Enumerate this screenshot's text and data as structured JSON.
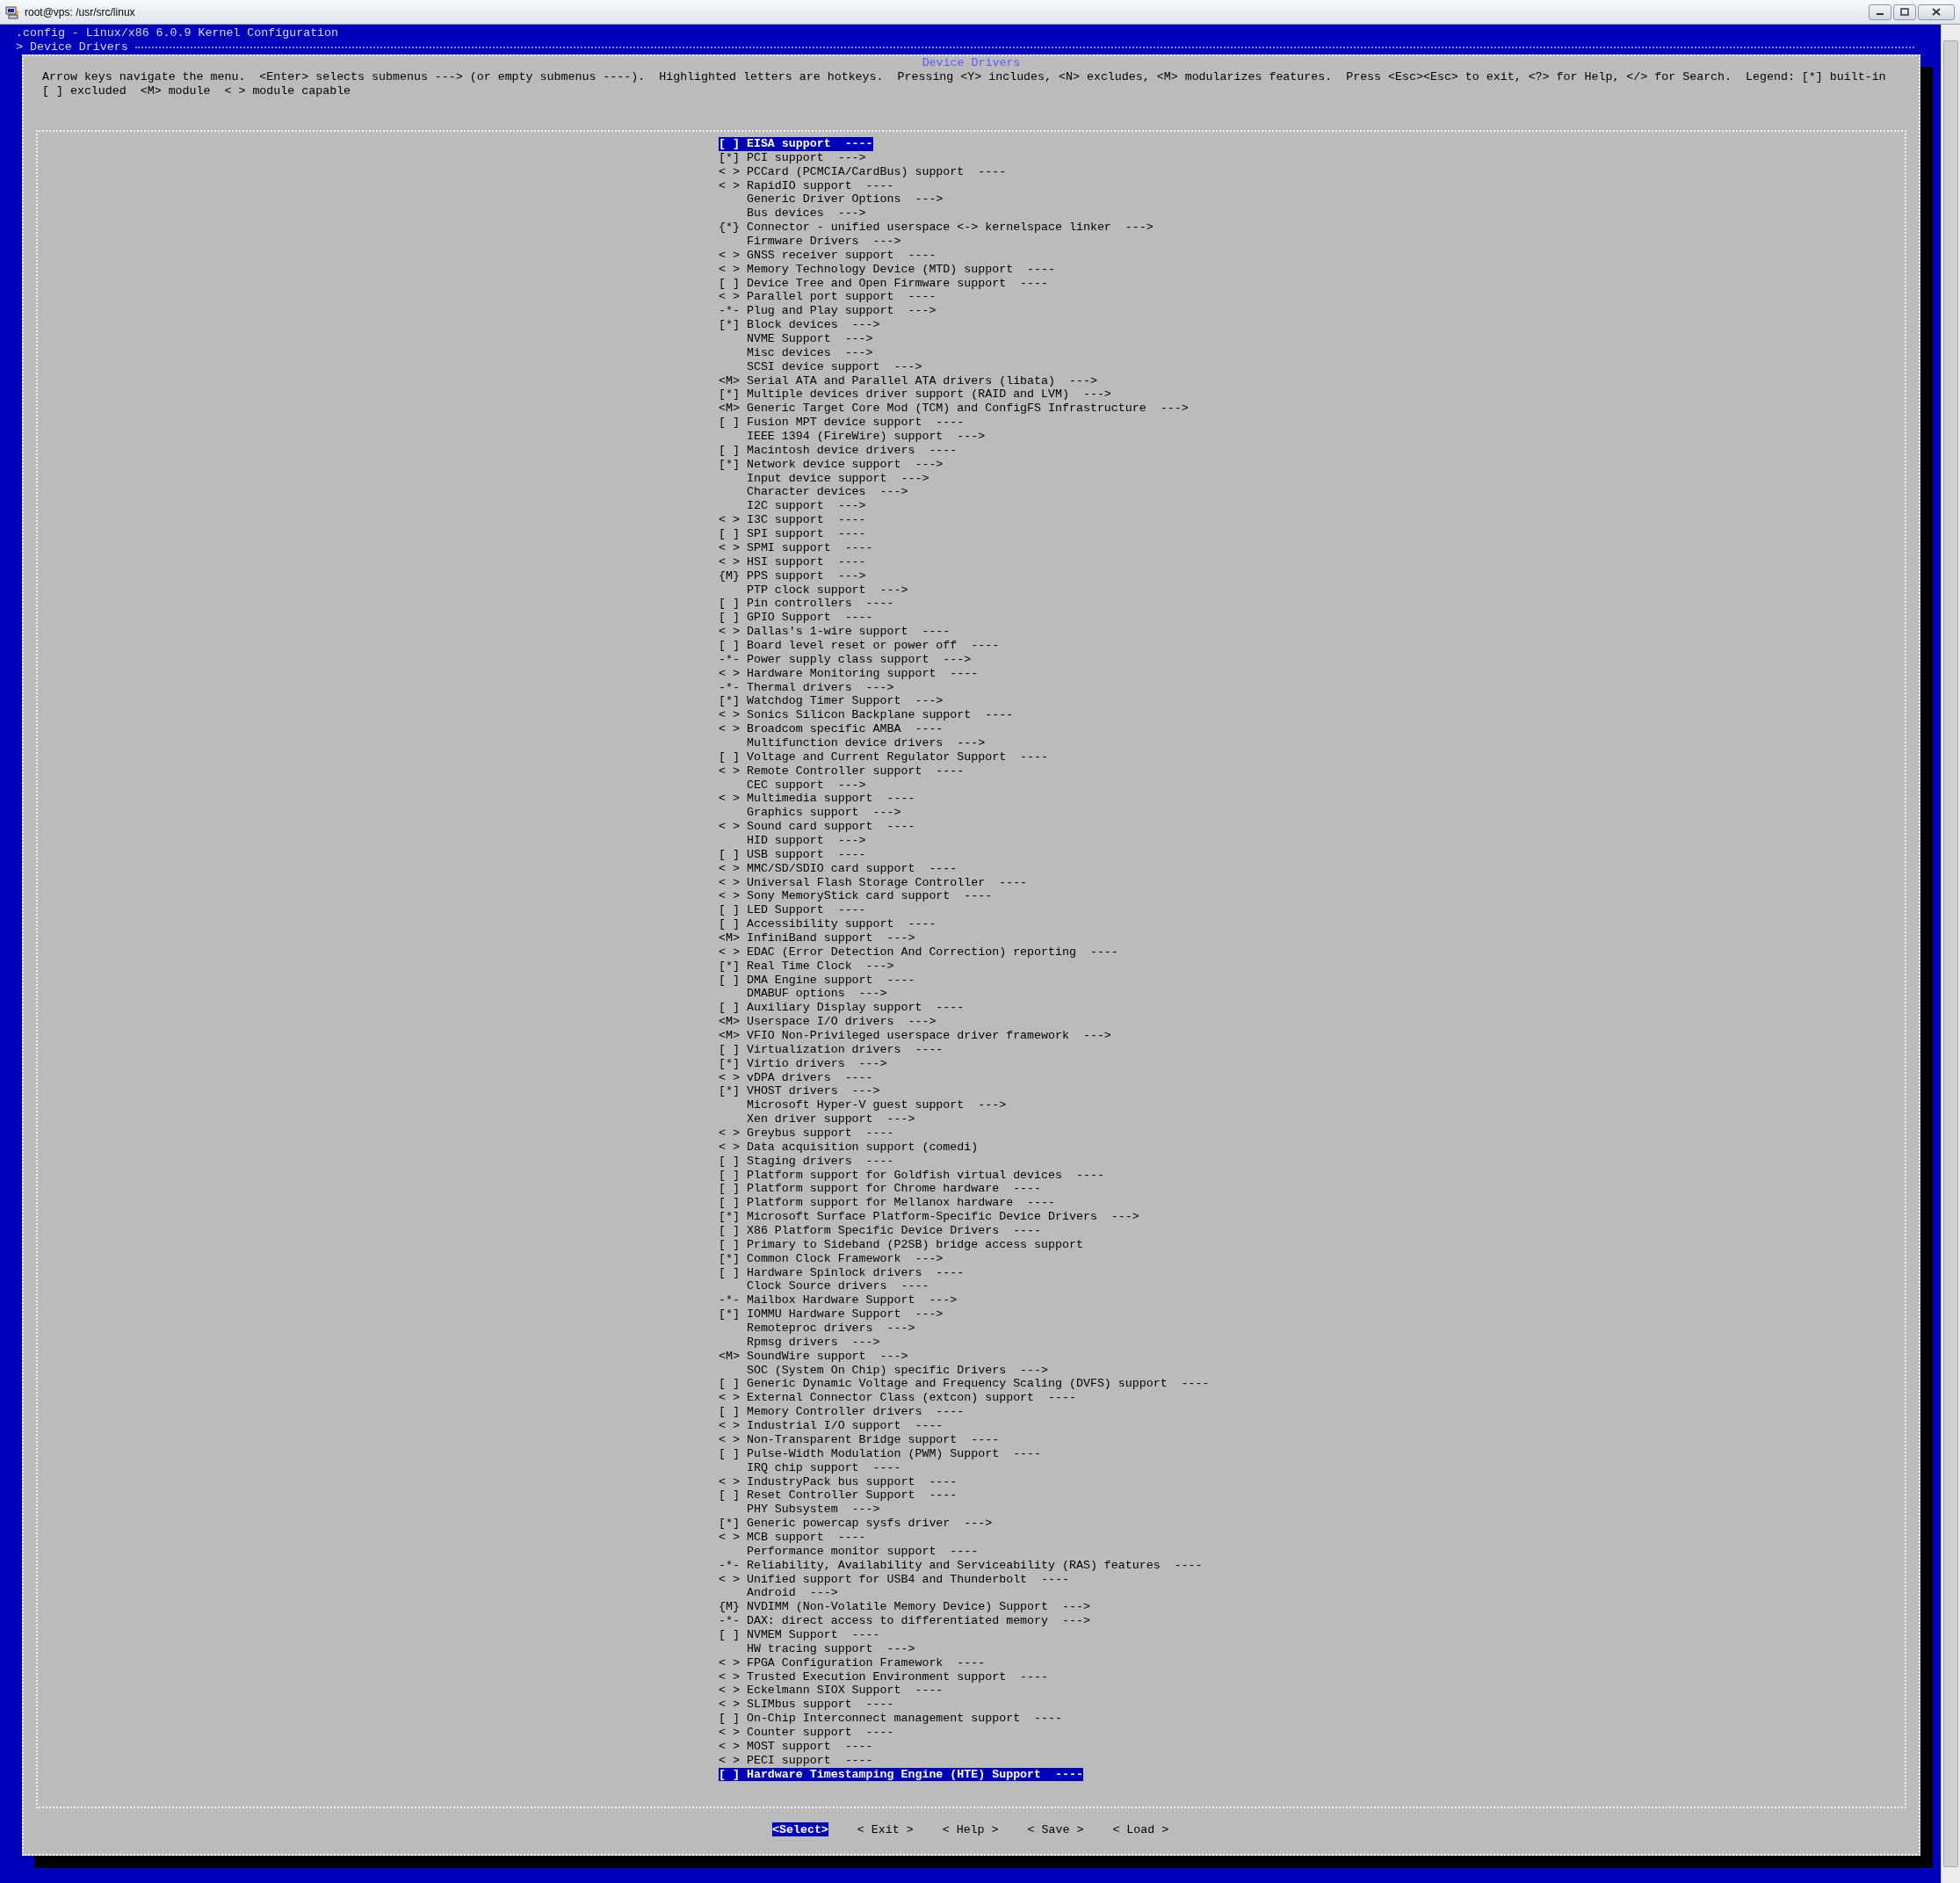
{
  "window": {
    "title": "root@vps: /usr/src/linux"
  },
  "terminal": {
    "heading": ".config - Linux/x86 6.0.9 Kernel Configuration",
    "breadcrumb": "> Device Drivers"
  },
  "dialog": {
    "title": "Device Drivers",
    "help": "Arrow keys navigate the menu.  <Enter> selects submenus ---> (or empty submenus ----).  Highlighted letters are hotkeys.  Pressing <Y> includes, <N> excludes, <M> modularizes features.  Press <Esc><Esc> to exit, <?> for Help, </> for Search.  Legend: [*] built-in [ ] excluded  <M> module  < > module capable",
    "items": [
      {
        "text": "[ ] EISA support  ----",
        "selected": true
      },
      {
        "text": "[*] PCI support  --->",
        "selected": false
      },
      {
        "text": "< > PCCard (PCMCIA/CardBus) support  ----",
        "selected": false
      },
      {
        "text": "< > RapidIO support  ----",
        "selected": false
      },
      {
        "text": "    Generic Driver Options  --->",
        "selected": false
      },
      {
        "text": "    Bus devices  --->",
        "selected": false
      },
      {
        "text": "{*} Connector - unified userspace <-> kernelspace linker  --->",
        "selected": false
      },
      {
        "text": "    Firmware Drivers  --->",
        "selected": false
      },
      {
        "text": "< > GNSS receiver support  ----",
        "selected": false
      },
      {
        "text": "< > Memory Technology Device (MTD) support  ----",
        "selected": false
      },
      {
        "text": "[ ] Device Tree and Open Firmware support  ----",
        "selected": false
      },
      {
        "text": "< > Parallel port support  ----",
        "selected": false
      },
      {
        "text": "-*- Plug and Play support  --->",
        "selected": false
      },
      {
        "text": "[*] Block devices  --->",
        "selected": false
      },
      {
        "text": "    NVME Support  --->",
        "selected": false
      },
      {
        "text": "    Misc devices  --->",
        "selected": false
      },
      {
        "text": "    SCSI device support  --->",
        "selected": false
      },
      {
        "text": "<M> Serial ATA and Parallel ATA drivers (libata)  --->",
        "selected": false
      },
      {
        "text": "[*] Multiple devices driver support (RAID and LVM)  --->",
        "selected": false
      },
      {
        "text": "<M> Generic Target Core Mod (TCM) and ConfigFS Infrastructure  --->",
        "selected": false
      },
      {
        "text": "[ ] Fusion MPT device support  ----",
        "selected": false
      },
      {
        "text": "    IEEE 1394 (FireWire) support  --->",
        "selected": false
      },
      {
        "text": "[ ] Macintosh device drivers  ----",
        "selected": false
      },
      {
        "text": "[*] Network device support  --->",
        "selected": false
      },
      {
        "text": "    Input device support  --->",
        "selected": false
      },
      {
        "text": "    Character devices  --->",
        "selected": false
      },
      {
        "text": "    I2C support  --->",
        "selected": false
      },
      {
        "text": "< > I3C support  ----",
        "selected": false
      },
      {
        "text": "[ ] SPI support  ----",
        "selected": false
      },
      {
        "text": "< > SPMI support  ----",
        "selected": false
      },
      {
        "text": "< > HSI support  ----",
        "selected": false
      },
      {
        "text": "{M} PPS support  --->",
        "selected": false
      },
      {
        "text": "    PTP clock support  --->",
        "selected": false
      },
      {
        "text": "[ ] Pin controllers  ----",
        "selected": false
      },
      {
        "text": "[ ] GPIO Support  ----",
        "selected": false
      },
      {
        "text": "< > Dallas's 1-wire support  ----",
        "selected": false
      },
      {
        "text": "[ ] Board level reset or power off  ----",
        "selected": false
      },
      {
        "text": "-*- Power supply class support  --->",
        "selected": false
      },
      {
        "text": "< > Hardware Monitoring support  ----",
        "selected": false
      },
      {
        "text": "-*- Thermal drivers  --->",
        "selected": false
      },
      {
        "text": "[*] Watchdog Timer Support  --->",
        "selected": false
      },
      {
        "text": "< > Sonics Silicon Backplane support  ----",
        "selected": false
      },
      {
        "text": "< > Broadcom specific AMBA  ----",
        "selected": false
      },
      {
        "text": "    Multifunction device drivers  --->",
        "selected": false
      },
      {
        "text": "[ ] Voltage and Current Regulator Support  ----",
        "selected": false
      },
      {
        "text": "< > Remote Controller support  ----",
        "selected": false
      },
      {
        "text": "    CEC support  --->",
        "selected": false
      },
      {
        "text": "< > Multimedia support  ----",
        "selected": false
      },
      {
        "text": "    Graphics support  --->",
        "selected": false
      },
      {
        "text": "< > Sound card support  ----",
        "selected": false
      },
      {
        "text": "    HID support  --->",
        "selected": false
      },
      {
        "text": "[ ] USB support  ----",
        "selected": false
      },
      {
        "text": "< > MMC/SD/SDIO card support  ----",
        "selected": false
      },
      {
        "text": "< > Universal Flash Storage Controller  ----",
        "selected": false
      },
      {
        "text": "< > Sony MemoryStick card support  ----",
        "selected": false
      },
      {
        "text": "[ ] LED Support  ----",
        "selected": false
      },
      {
        "text": "[ ] Accessibility support  ----",
        "selected": false
      },
      {
        "text": "<M> InfiniBand support  --->",
        "selected": false
      },
      {
        "text": "< > EDAC (Error Detection And Correction) reporting  ----",
        "selected": false
      },
      {
        "text": "[*] Real Time Clock  --->",
        "selected": false
      },
      {
        "text": "[ ] DMA Engine support  ----",
        "selected": false
      },
      {
        "text": "    DMABUF options  --->",
        "selected": false
      },
      {
        "text": "[ ] Auxiliary Display support  ----",
        "selected": false
      },
      {
        "text": "<M> Userspace I/O drivers  --->",
        "selected": false
      },
      {
        "text": "<M> VFIO Non-Privileged userspace driver framework  --->",
        "selected": false
      },
      {
        "text": "[ ] Virtualization drivers  ----",
        "selected": false
      },
      {
        "text": "[*] Virtio drivers  --->",
        "selected": false
      },
      {
        "text": "< > vDPA drivers  ----",
        "selected": false
      },
      {
        "text": "[*] VHOST drivers  --->",
        "selected": false
      },
      {
        "text": "    Microsoft Hyper-V guest support  --->",
        "selected": false
      },
      {
        "text": "    Xen driver support  --->",
        "selected": false
      },
      {
        "text": "< > Greybus support  ----",
        "selected": false
      },
      {
        "text": "< > Data acquisition support (comedi)",
        "selected": false
      },
      {
        "text": "[ ] Staging drivers  ----",
        "selected": false
      },
      {
        "text": "[ ] Platform support for Goldfish virtual devices  ----",
        "selected": false
      },
      {
        "text": "[ ] Platform support for Chrome hardware  ----",
        "selected": false
      },
      {
        "text": "[ ] Platform support for Mellanox hardware  ----",
        "selected": false
      },
      {
        "text": "[*] Microsoft Surface Platform-Specific Device Drivers  --->",
        "selected": false
      },
      {
        "text": "[ ] X86 Platform Specific Device Drivers  ----",
        "selected": false
      },
      {
        "text": "[ ] Primary to Sideband (P2SB) bridge access support",
        "selected": false
      },
      {
        "text": "[*] Common Clock Framework  --->",
        "selected": false
      },
      {
        "text": "[ ] Hardware Spinlock drivers  ----",
        "selected": false
      },
      {
        "text": "    Clock Source drivers  ----",
        "selected": false
      },
      {
        "text": "-*- Mailbox Hardware Support  --->",
        "selected": false
      },
      {
        "text": "[*] IOMMU Hardware Support  --->",
        "selected": false
      },
      {
        "text": "    Remoteproc drivers  --->",
        "selected": false
      },
      {
        "text": "    Rpmsg drivers  --->",
        "selected": false
      },
      {
        "text": "<M> SoundWire support  --->",
        "selected": false
      },
      {
        "text": "    SOC (System On Chip) specific Drivers  --->",
        "selected": false
      },
      {
        "text": "[ ] Generic Dynamic Voltage and Frequency Scaling (DVFS) support  ----",
        "selected": false
      },
      {
        "text": "< > External Connector Class (extcon) support  ----",
        "selected": false
      },
      {
        "text": "[ ] Memory Controller drivers  ----",
        "selected": false
      },
      {
        "text": "< > Industrial I/O support  ----",
        "selected": false
      },
      {
        "text": "< > Non-Transparent Bridge support  ----",
        "selected": false
      },
      {
        "text": "[ ] Pulse-Width Modulation (PWM) Support  ----",
        "selected": false
      },
      {
        "text": "    IRQ chip support  ----",
        "selected": false
      },
      {
        "text": "< > IndustryPack bus support  ----",
        "selected": false
      },
      {
        "text": "[ ] Reset Controller Support  ----",
        "selected": false
      },
      {
        "text": "    PHY Subsystem  --->",
        "selected": false
      },
      {
        "text": "[*] Generic powercap sysfs driver  --->",
        "selected": false
      },
      {
        "text": "< > MCB support  ----",
        "selected": false
      },
      {
        "text": "    Performance monitor support  ----",
        "selected": false
      },
      {
        "text": "-*- Reliability, Availability and Serviceability (RAS) features  ----",
        "selected": false
      },
      {
        "text": "< > Unified support for USB4 and Thunderbolt  ----",
        "selected": false
      },
      {
        "text": "    Android  --->",
        "selected": false
      },
      {
        "text": "{M} NVDIMM (Non-Volatile Memory Device) Support  --->",
        "selected": false
      },
      {
        "text": "-*- DAX: direct access to differentiated memory  --->",
        "selected": false
      },
      {
        "text": "[ ] NVMEM Support  ----",
        "selected": false
      },
      {
        "text": "    HW tracing support  --->",
        "selected": false
      },
      {
        "text": "< > FPGA Configuration Framework  ----",
        "selected": false
      },
      {
        "text": "< > Trusted Execution Environment support  ----",
        "selected": false
      },
      {
        "text": "< > Eckelmann SIOX Support  ----",
        "selected": false
      },
      {
        "text": "< > SLIMbus support  ----",
        "selected": false
      },
      {
        "text": "[ ] On-Chip Interconnect management support  ----",
        "selected": false
      },
      {
        "text": "< > Counter support  ----",
        "selected": false
      },
      {
        "text": "< > MOST support  ----",
        "selected": false
      },
      {
        "text": "< > PECI support  ----",
        "selected": false
      },
      {
        "text": "[ ] Hardware Timestamping Engine (HTE) Support  ----",
        "selected": true
      }
    ],
    "buttons": [
      {
        "label": "<Select>",
        "selected": true
      },
      {
        "label": "< Exit >",
        "selected": false
      },
      {
        "label": "< Help >",
        "selected": false
      },
      {
        "label": "< Save >",
        "selected": false
      },
      {
        "label": "< Load >",
        "selected": false
      }
    ]
  }
}
